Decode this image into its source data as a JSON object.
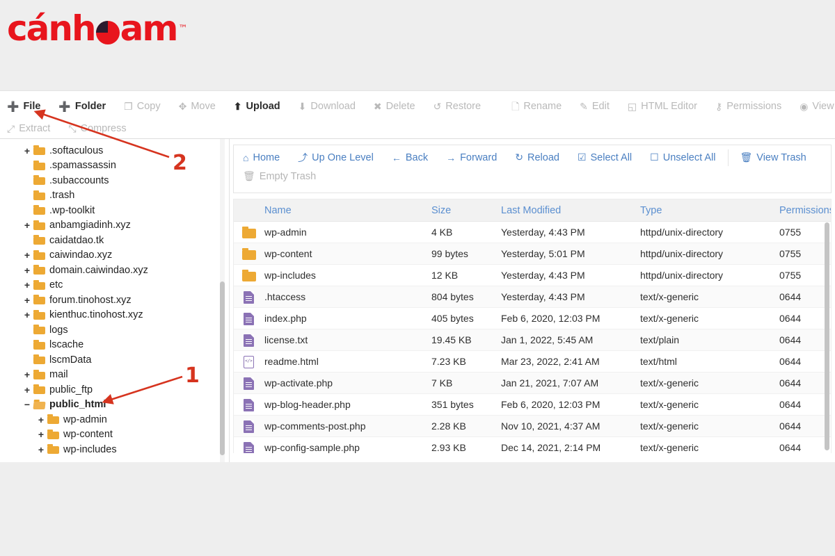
{
  "brand": {
    "name_part1": "cánh",
    "name_part2": "am",
    "trademark": "™",
    "accent_color": "#e8151d",
    "logo_icon": "pie-circle-icon"
  },
  "toolbar": {
    "rows": [
      [
        {
          "label": "File",
          "icon": "plus-icon",
          "glyph": "➕",
          "enabled": true
        },
        {
          "label": "Folder",
          "icon": "plus-icon",
          "glyph": "➕",
          "enabled": true
        },
        {
          "label": "Copy",
          "icon": "copy-icon",
          "glyph": "❐",
          "enabled": false
        },
        {
          "label": "Move",
          "icon": "move-icon",
          "glyph": "✥",
          "enabled": false
        },
        {
          "label": "Upload",
          "icon": "upload-icon",
          "glyph": "⬆",
          "enabled": true
        },
        {
          "label": "Download",
          "icon": "download-icon",
          "glyph": "⬇",
          "enabled": false
        },
        {
          "label": "Delete",
          "icon": "x-icon",
          "glyph": "✖",
          "enabled": false
        },
        {
          "label": "Restore",
          "icon": "restore-icon",
          "glyph": "↺",
          "enabled": false
        },
        {
          "separator": true
        },
        {
          "label": "Rename",
          "icon": "file-icon",
          "glyph": "🗋",
          "enabled": false
        },
        {
          "label": "Edit",
          "icon": "pencil-icon",
          "glyph": "✎",
          "enabled": false
        },
        {
          "label": "HTML Editor",
          "icon": "html-editor-icon",
          "glyph": "◱",
          "enabled": false
        },
        {
          "label": "Permissions",
          "icon": "key-icon",
          "glyph": "⚷",
          "enabled": false
        },
        {
          "label": "View",
          "icon": "eye-icon",
          "glyph": "◉",
          "enabled": false
        }
      ],
      [
        {
          "label": "Extract",
          "icon": "extract-icon",
          "glyph": "⤢",
          "enabled": false
        },
        {
          "label": "Compress",
          "icon": "compress-icon",
          "glyph": "⤡",
          "enabled": false
        }
      ]
    ]
  },
  "tree": {
    "items": [
      {
        "label": ".softaculous",
        "indent": 0,
        "toggle": "+",
        "state": "closed"
      },
      {
        "label": ".spamassassin",
        "indent": 0,
        "toggle": "",
        "state": "closed"
      },
      {
        "label": ".subaccounts",
        "indent": 0,
        "toggle": "",
        "state": "closed"
      },
      {
        "label": ".trash",
        "indent": 0,
        "toggle": "",
        "state": "closed"
      },
      {
        "label": ".wp-toolkit",
        "indent": 0,
        "toggle": "",
        "state": "closed"
      },
      {
        "label": "anbamgiadinh.xyz",
        "indent": 0,
        "toggle": "+",
        "state": "closed"
      },
      {
        "label": "caidatdao.tk",
        "indent": 0,
        "toggle": "",
        "state": "closed"
      },
      {
        "label": "caiwindao.xyz",
        "indent": 0,
        "toggle": "+",
        "state": "closed"
      },
      {
        "label": "domain.caiwindao.xyz",
        "indent": 0,
        "toggle": "+",
        "state": "closed"
      },
      {
        "label": "etc",
        "indent": 0,
        "toggle": "+",
        "state": "closed"
      },
      {
        "label": "forum.tinohost.xyz",
        "indent": 0,
        "toggle": "+",
        "state": "closed"
      },
      {
        "label": "kienthuc.tinohost.xyz",
        "indent": 0,
        "toggle": "+",
        "state": "closed"
      },
      {
        "label": "logs",
        "indent": 0,
        "toggle": "",
        "state": "closed"
      },
      {
        "label": "lscache",
        "indent": 0,
        "toggle": "",
        "state": "closed"
      },
      {
        "label": "lscmData",
        "indent": 0,
        "toggle": "",
        "state": "closed"
      },
      {
        "label": "mail",
        "indent": 0,
        "toggle": "+",
        "state": "closed"
      },
      {
        "label": "public_ftp",
        "indent": 0,
        "toggle": "+",
        "state": "closed"
      },
      {
        "label": "public_html",
        "indent": 0,
        "toggle": "−",
        "state": "open",
        "selected": true
      },
      {
        "label": "wp-admin",
        "indent": 1,
        "toggle": "+",
        "state": "closed"
      },
      {
        "label": "wp-content",
        "indent": 1,
        "toggle": "+",
        "state": "closed"
      },
      {
        "label": "wp-includes",
        "indent": 1,
        "toggle": "+",
        "state": "closed"
      }
    ]
  },
  "file_manager": {
    "actions": [
      {
        "label": "Home",
        "icon": "home-icon",
        "glyph": "⌂",
        "enabled": true
      },
      {
        "label": "Up One Level",
        "icon": "up-arrow-icon",
        "glyph": "⤴",
        "enabled": true
      },
      {
        "label": "Back",
        "icon": "arrow-left-icon",
        "glyph": "←",
        "enabled": true
      },
      {
        "label": "Forward",
        "icon": "arrow-right-icon",
        "glyph": "→",
        "enabled": true
      },
      {
        "label": "Reload",
        "icon": "reload-icon",
        "glyph": "↻",
        "enabled": true
      },
      {
        "label": "Select All",
        "icon": "checkbox-checked-icon",
        "glyph": "☑",
        "enabled": true
      },
      {
        "label": "Unselect All",
        "icon": "checkbox-empty-icon",
        "glyph": "☐",
        "enabled": true
      },
      {
        "separator": true
      },
      {
        "label": "View Trash",
        "icon": "trash-icon",
        "glyph": "🗑",
        "enabled": true
      },
      {
        "newline": true
      },
      {
        "label": "Empty Trash",
        "icon": "trash-icon",
        "glyph": "🗑",
        "enabled": false
      }
    ],
    "columns": [
      "Name",
      "Size",
      "Last Modified",
      "Type",
      "Permissions"
    ],
    "rows": [
      {
        "icon": "folder-icon",
        "kind": "folder",
        "name": "wp-admin",
        "size": "4 KB",
        "modified": "Yesterday, 4:43 PM",
        "type": "httpd/unix-directory",
        "permissions": "0755"
      },
      {
        "icon": "folder-icon",
        "kind": "folder",
        "name": "wp-content",
        "size": "99 bytes",
        "modified": "Yesterday, 5:01 PM",
        "type": "httpd/unix-directory",
        "permissions": "0755"
      },
      {
        "icon": "folder-icon",
        "kind": "folder",
        "name": "wp-includes",
        "size": "12 KB",
        "modified": "Yesterday, 4:43 PM",
        "type": "httpd/unix-directory",
        "permissions": "0755"
      },
      {
        "icon": "file-icon",
        "kind": "file",
        "name": ".htaccess",
        "size": "804 bytes",
        "modified": "Yesterday, 4:43 PM",
        "type": "text/x-generic",
        "permissions": "0644"
      },
      {
        "icon": "file-icon",
        "kind": "file",
        "name": "index.php",
        "size": "405 bytes",
        "modified": "Feb 6, 2020, 12:03 PM",
        "type": "text/x-generic",
        "permissions": "0644"
      },
      {
        "icon": "file-icon",
        "kind": "file",
        "name": "license.txt",
        "size": "19.45 KB",
        "modified": "Jan 1, 2022, 5:45 AM",
        "type": "text/plain",
        "permissions": "0644"
      },
      {
        "icon": "html-file-icon",
        "kind": "html",
        "name": "readme.html",
        "size": "7.23 KB",
        "modified": "Mar 23, 2022, 2:41 AM",
        "type": "text/html",
        "permissions": "0644"
      },
      {
        "icon": "file-icon",
        "kind": "file",
        "name": "wp-activate.php",
        "size": "7 KB",
        "modified": "Jan 21, 2021, 7:07 AM",
        "type": "text/x-generic",
        "permissions": "0644"
      },
      {
        "icon": "file-icon",
        "kind": "file",
        "name": "wp-blog-header.php",
        "size": "351 bytes",
        "modified": "Feb 6, 2020, 12:03 PM",
        "type": "text/x-generic",
        "permissions": "0644"
      },
      {
        "icon": "file-icon",
        "kind": "file",
        "name": "wp-comments-post.php",
        "size": "2.28 KB",
        "modified": "Nov 10, 2021, 4:37 AM",
        "type": "text/x-generic",
        "permissions": "0644"
      },
      {
        "icon": "file-icon",
        "kind": "file",
        "name": "wp-config-sample.php",
        "size": "2.93 KB",
        "modified": "Dec 14, 2021, 2:14 PM",
        "type": "text/x-generic",
        "permissions": "0644"
      }
    ]
  },
  "annotations": {
    "color": "#d6341f",
    "markers": [
      {
        "number": "1",
        "points_at": "public_html"
      },
      {
        "number": "2",
        "points_at": "File"
      }
    ]
  }
}
